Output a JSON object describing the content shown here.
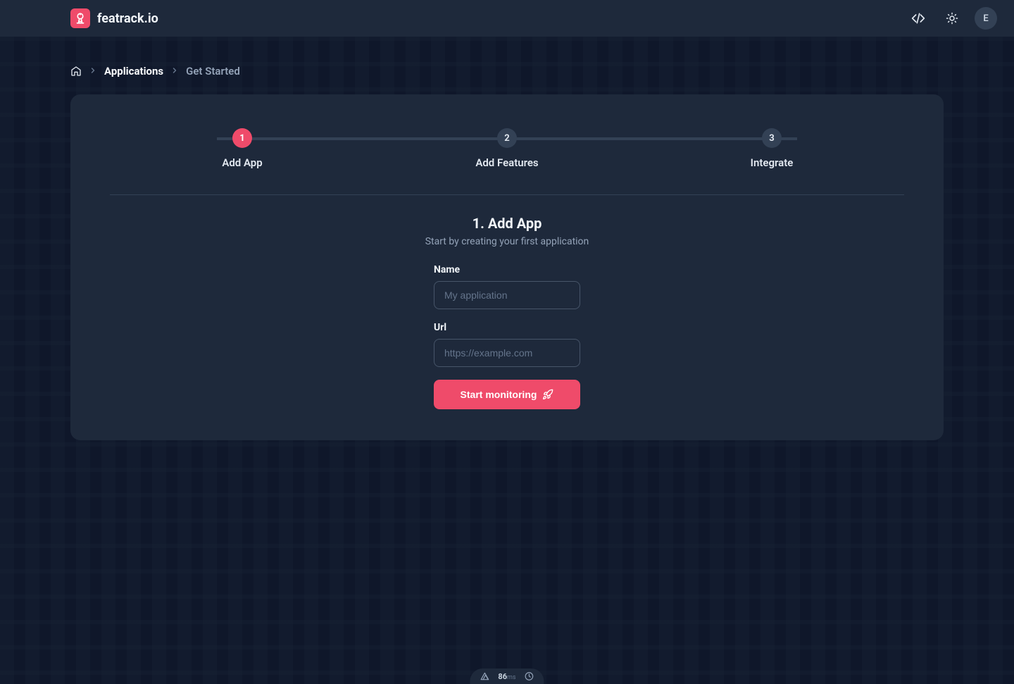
{
  "header": {
    "brand": "featrack.io",
    "avatar_initial": "E"
  },
  "breadcrumb": {
    "link1": "Applications",
    "current": "Get Started"
  },
  "stepper": {
    "steps": [
      {
        "num": "1",
        "label": "Add App",
        "active": true
      },
      {
        "num": "2",
        "label": "Add Features",
        "active": false
      },
      {
        "num": "3",
        "label": "Integrate",
        "active": false
      }
    ]
  },
  "section": {
    "title": "1. Add App",
    "subtitle": "Start by creating your first application"
  },
  "form": {
    "name_label": "Name",
    "name_placeholder": "My application",
    "url_label": "Url",
    "url_placeholder": "https://example.com",
    "submit_label": "Start monitoring"
  },
  "devtoolbar": {
    "value": "86",
    "unit": "ms"
  }
}
